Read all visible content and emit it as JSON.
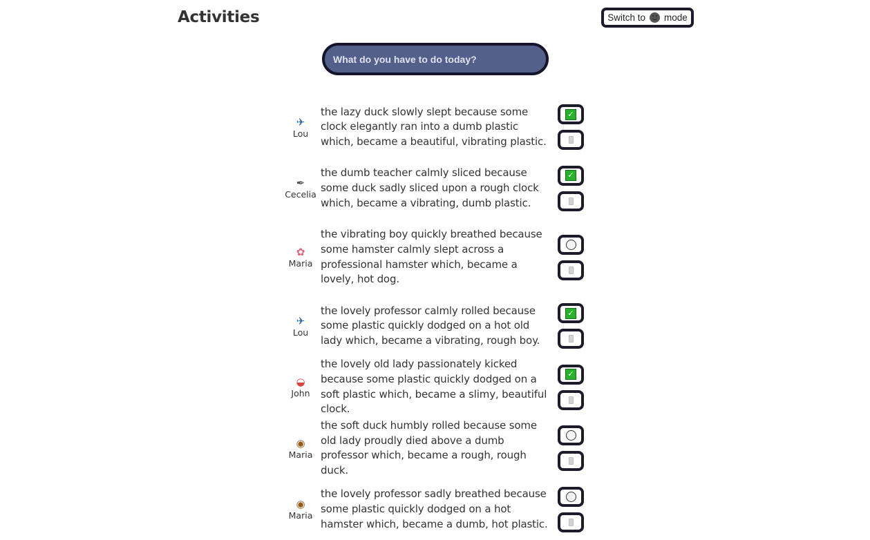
{
  "header": {
    "title": "Activities",
    "mode_button": {
      "prefix": "Switch to",
      "icon": "dark-smiley-icon",
      "suffix": "mode"
    }
  },
  "input": {
    "placeholder": "What do you have to do today?",
    "value": ""
  },
  "colors": {
    "input_bg": "#52608a",
    "border_dark": "#1b1b2a",
    "check_green": "#27b22b",
    "text": "#333333"
  },
  "items": [
    {
      "user": "Lou",
      "avatar_icon": "✈",
      "avatar_name": "airplane-icon",
      "avatar_color": "#2a6fb5",
      "text": "the lazy duck slowly slept because some clock elegantly ran into a dumb plastic which, became a beautiful, vibrating plastic.",
      "done": true
    },
    {
      "user": "Cecelia",
      "avatar_icon": "✒",
      "avatar_name": "pen-icon",
      "avatar_color": "#555555",
      "text": "the dumb teacher calmly sliced because some duck sadly sliced upon a rough clock which, became a vibrating, dumb plastic.",
      "done": true
    },
    {
      "user": "Maria",
      "avatar_icon": "✿",
      "avatar_name": "cherry-blossom-icon",
      "avatar_color": "#e0607e",
      "text": "the vibrating boy quickly breathed because some hamster calmly slept across a professional hamster which, became a lovely, hot dog.",
      "done": false
    },
    {
      "user": "Lou",
      "avatar_icon": "✈",
      "avatar_name": "airplane-icon",
      "avatar_color": "#2a6fb5",
      "text": "the lovely professor calmly rolled because some plastic quickly dodged on a hot old lady which, became a vibrating, rough boy.",
      "done": true
    },
    {
      "user": "John",
      "avatar_icon": "◒",
      "avatar_name": "sushi-icon",
      "avatar_color": "#d9453d",
      "text": "the lovely old lady passionately kicked because some plastic quickly dodged on a soft plastic which, became a slimy, beautiful clock.",
      "done": true
    },
    {
      "user": "Maria",
      "avatar_icon": "◉",
      "avatar_name": "donut-icon",
      "avatar_color": "#9a5a1c",
      "text": "the soft duck humbly rolled because some old lady proudly died above a dumb professor which, became a rough, rough duck.",
      "done": false
    },
    {
      "user": "Maria",
      "avatar_icon": "◉",
      "avatar_name": "donut-icon",
      "avatar_color": "#9a5a1c",
      "text": "the lovely professor sadly breathed because some plastic quickly dodged on a hot hamster which, became a dumb, hot plastic.",
      "done": false
    }
  ]
}
